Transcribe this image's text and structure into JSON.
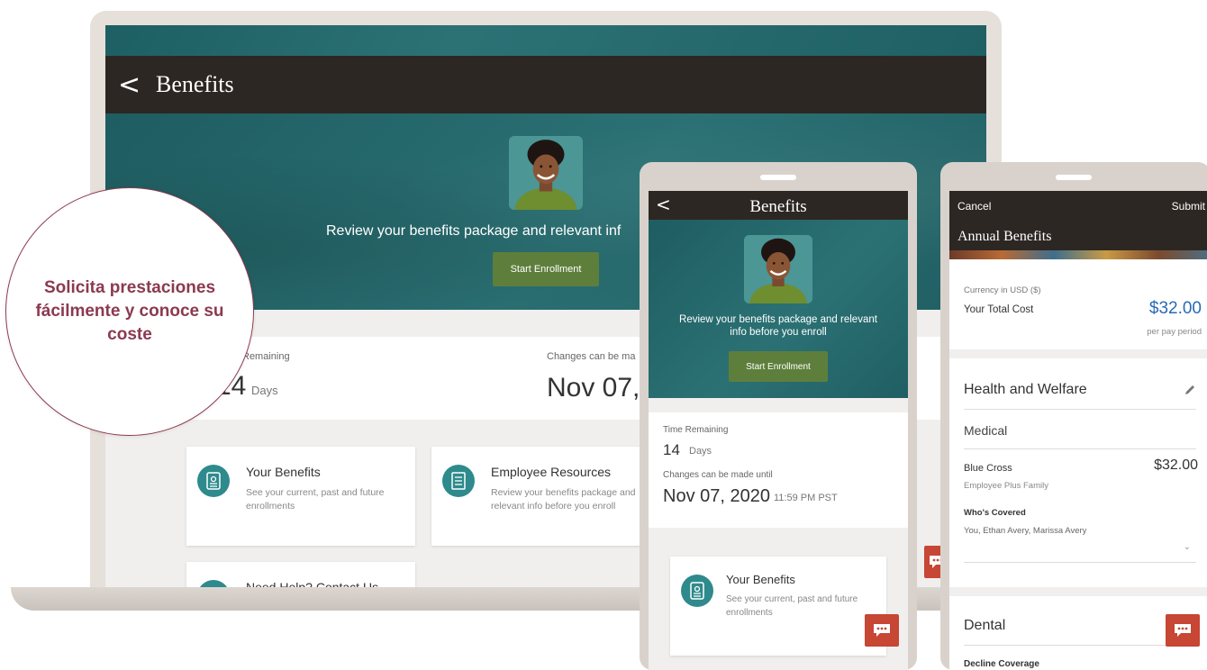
{
  "laptop": {
    "header": {
      "back": "<",
      "title": "Benefits"
    },
    "hero": {
      "text": "Review your benefits package and relevant inf",
      "button": "Start Enrollment"
    },
    "stats": {
      "remaining_label": "Remaining",
      "remaining_value": "14",
      "remaining_unit": "Days",
      "changes_label": "Changes can be ma",
      "changes_date": "Nov 07,"
    },
    "cards": [
      {
        "title": "Your Benefits",
        "desc": "See your current, past and future enrollments"
      },
      {
        "title": "Employee Resources",
        "desc": "Review your benefits package and relevant info before you enroll"
      },
      {
        "title": "Need Help? Contact Us"
      }
    ]
  },
  "callout": {
    "text": "Solicita prestaciones fácilmente y conoce su coste"
  },
  "phone1": {
    "header": {
      "back": "<",
      "title": "Benefits"
    },
    "hero": {
      "text": "Review your benefits package and relevant info before you enroll",
      "button": "Start Enrollment"
    },
    "stats": {
      "time_label": "Time Remaining",
      "time_value": "14",
      "time_unit": "Days",
      "changes_label": "Changes can be made until",
      "changes_date": "Nov 07, 2020",
      "changes_time": "11:59 PM PST"
    },
    "card": {
      "title": "Your Benefits",
      "desc": "See your current, past and future enrollments"
    }
  },
  "phone2": {
    "header": {
      "cancel": "Cancel",
      "submit": "Submit",
      "title": "Annual Benefits"
    },
    "summary": {
      "currency": "Currency in USD ($)",
      "total_label": "Your Total Cost",
      "total_value": "$32.00",
      "period": "per pay period"
    },
    "health": {
      "title": "Health and Welfare",
      "medical": "Medical",
      "plan_name": "Blue Cross",
      "plan_cost": "$32.00",
      "plan_level": "Employee Plus Family",
      "covered_label": "Who's Covered",
      "covered_names": "You, Ethan Avery, Marissa Avery"
    },
    "dental": {
      "title": "Dental",
      "option": "Decline Coverage"
    }
  },
  "colors": {
    "teal": "#2b7174",
    "dark_header": "#2d2723",
    "button_green": "#5e7f3c",
    "chat_red": "#c74634",
    "accent_maroon": "#8b3a50",
    "price_blue": "#2a6ab5"
  }
}
